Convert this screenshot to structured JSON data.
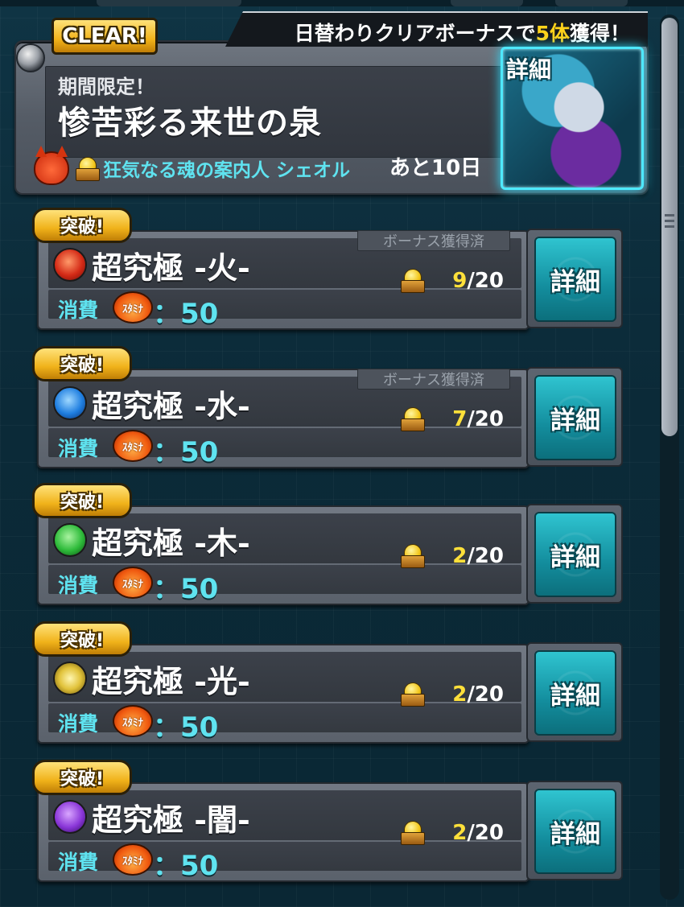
{
  "event": {
    "clear_badge": "CLEAR!",
    "bonus_text_prefix": "日替わりクリアボーナスで",
    "bonus_count": "5体",
    "bonus_text_suffix": "獲得！",
    "limited_label": "期間限定！",
    "title": "惨苦彩る来世の泉",
    "boss_name": "狂気なる魂の案内人 シェオル",
    "days_left": "あと10日",
    "detail_label": "詳細"
  },
  "quests": [
    {
      "badge": "突破!",
      "element": "fire",
      "name": "超究極 -火-",
      "bonus_status": "ボーナス獲得済",
      "current": "9",
      "total": "/20",
      "cost_label": "消費",
      "stamina_label": "ｽﾀﾐﾅ",
      "cost_value": "：50",
      "detail_label": "詳細"
    },
    {
      "badge": "突破!",
      "element": "water",
      "name": "超究極 -水-",
      "bonus_status": "ボーナス獲得済",
      "current": "7",
      "total": "/20",
      "cost_label": "消費",
      "stamina_label": "ｽﾀﾐﾅ",
      "cost_value": "：50",
      "detail_label": "詳細"
    },
    {
      "badge": "突破!",
      "element": "wood",
      "name": "超究極 -木-",
      "bonus_status": "",
      "current": "2",
      "total": "/20",
      "cost_label": "消費",
      "stamina_label": "ｽﾀﾐﾅ",
      "cost_value": "：50",
      "detail_label": "詳細"
    },
    {
      "badge": "突破!",
      "element": "light",
      "name": "超究極 -光-",
      "bonus_status": "",
      "current": "2",
      "total": "/20",
      "cost_label": "消費",
      "stamina_label": "ｽﾀﾐﾅ",
      "cost_value": "：50",
      "detail_label": "詳細"
    },
    {
      "badge": "突破!",
      "element": "dark",
      "name": "超究極 -闇-",
      "bonus_status": "",
      "current": "2",
      "total": "/20",
      "cost_label": "消費",
      "stamina_label": "ｽﾀﾐﾅ",
      "cost_value": "：50",
      "detail_label": "詳細"
    }
  ],
  "scrollbar": {
    "thumb_fraction": 0.47
  },
  "colors": {
    "accent_cyan": "#5fe3f0",
    "gold": "#ffe03a",
    "badge_gold": "#f0b21a"
  }
}
